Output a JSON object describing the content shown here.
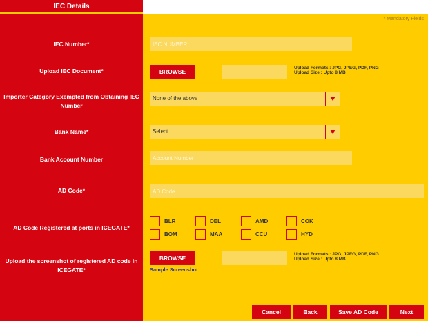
{
  "tab": {
    "title": "IEC Details"
  },
  "mandatory_note": "* Mandatory Fields",
  "labels": {
    "iec_number": "IEC Number*",
    "upload_iec": "Upload IEC Document*",
    "importer_category": "Importer Category Exempted from Obtaining IEC Number",
    "bank_name": "Bank Name*",
    "bank_account": "Bank Account Number",
    "ad_code": "AD Code*",
    "ad_ports": "AD Code Registered at ports in ICEGATE*",
    "screenshot": "Upload the screenshot of registered AD code in ICEGATE*"
  },
  "fields": {
    "iec_number": {
      "placeholder": "IEC NUMBER",
      "value": ""
    },
    "upload_iec_file": {
      "value": ""
    },
    "importer_category": {
      "selected": "None of the above"
    },
    "bank_name": {
      "selected": "Select"
    },
    "bank_account": {
      "placeholder": "Account Number",
      "value": ""
    },
    "ad_code": {
      "placeholder": "AD Code",
      "value": ""
    },
    "screenshot_file": {
      "value": ""
    }
  },
  "browse_label": "BROWSE",
  "upload_note": {
    "formats": "Upload Formats : JPG, JPEG, PDF, PNG",
    "size": "Upload Size : Upto 8 MB"
  },
  "sample_link": "Sample Screenshot",
  "ports": [
    "BLR",
    "DEL",
    "AMD",
    "COK",
    "BOM",
    "MAA",
    "CCU",
    "HYD"
  ],
  "buttons": {
    "cancel": "Cancel",
    "back": "Back",
    "save": "Save AD Code",
    "next": "Next"
  },
  "colors": {
    "red": "#d40511",
    "yellow": "#ffcc00",
    "field": "#fbd85e"
  }
}
